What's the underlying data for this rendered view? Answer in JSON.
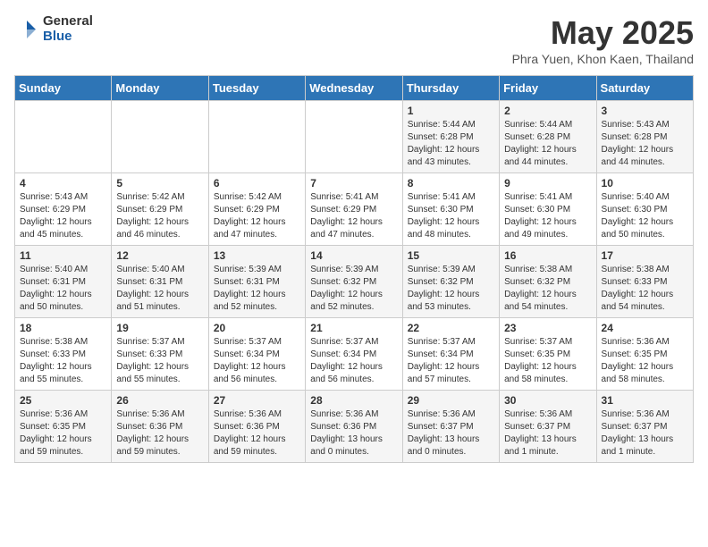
{
  "header": {
    "logo_general": "General",
    "logo_blue": "Blue",
    "title": "May 2025",
    "subtitle": "Phra Yuen, Khon Kaen, Thailand"
  },
  "weekdays": [
    "Sunday",
    "Monday",
    "Tuesday",
    "Wednesday",
    "Thursday",
    "Friday",
    "Saturday"
  ],
  "weeks": [
    [
      {
        "day": "",
        "info": ""
      },
      {
        "day": "",
        "info": ""
      },
      {
        "day": "",
        "info": ""
      },
      {
        "day": "",
        "info": ""
      },
      {
        "day": "1",
        "info": "Sunrise: 5:44 AM\nSunset: 6:28 PM\nDaylight: 12 hours\nand 43 minutes."
      },
      {
        "day": "2",
        "info": "Sunrise: 5:44 AM\nSunset: 6:28 PM\nDaylight: 12 hours\nand 44 minutes."
      },
      {
        "day": "3",
        "info": "Sunrise: 5:43 AM\nSunset: 6:28 PM\nDaylight: 12 hours\nand 44 minutes."
      }
    ],
    [
      {
        "day": "4",
        "info": "Sunrise: 5:43 AM\nSunset: 6:29 PM\nDaylight: 12 hours\nand 45 minutes."
      },
      {
        "day": "5",
        "info": "Sunrise: 5:42 AM\nSunset: 6:29 PM\nDaylight: 12 hours\nand 46 minutes."
      },
      {
        "day": "6",
        "info": "Sunrise: 5:42 AM\nSunset: 6:29 PM\nDaylight: 12 hours\nand 47 minutes."
      },
      {
        "day": "7",
        "info": "Sunrise: 5:41 AM\nSunset: 6:29 PM\nDaylight: 12 hours\nand 47 minutes."
      },
      {
        "day": "8",
        "info": "Sunrise: 5:41 AM\nSunset: 6:30 PM\nDaylight: 12 hours\nand 48 minutes."
      },
      {
        "day": "9",
        "info": "Sunrise: 5:41 AM\nSunset: 6:30 PM\nDaylight: 12 hours\nand 49 minutes."
      },
      {
        "day": "10",
        "info": "Sunrise: 5:40 AM\nSunset: 6:30 PM\nDaylight: 12 hours\nand 50 minutes."
      }
    ],
    [
      {
        "day": "11",
        "info": "Sunrise: 5:40 AM\nSunset: 6:31 PM\nDaylight: 12 hours\nand 50 minutes."
      },
      {
        "day": "12",
        "info": "Sunrise: 5:40 AM\nSunset: 6:31 PM\nDaylight: 12 hours\nand 51 minutes."
      },
      {
        "day": "13",
        "info": "Sunrise: 5:39 AM\nSunset: 6:31 PM\nDaylight: 12 hours\nand 52 minutes."
      },
      {
        "day": "14",
        "info": "Sunrise: 5:39 AM\nSunset: 6:32 PM\nDaylight: 12 hours\nand 52 minutes."
      },
      {
        "day": "15",
        "info": "Sunrise: 5:39 AM\nSunset: 6:32 PM\nDaylight: 12 hours\nand 53 minutes."
      },
      {
        "day": "16",
        "info": "Sunrise: 5:38 AM\nSunset: 6:32 PM\nDaylight: 12 hours\nand 54 minutes."
      },
      {
        "day": "17",
        "info": "Sunrise: 5:38 AM\nSunset: 6:33 PM\nDaylight: 12 hours\nand 54 minutes."
      }
    ],
    [
      {
        "day": "18",
        "info": "Sunrise: 5:38 AM\nSunset: 6:33 PM\nDaylight: 12 hours\nand 55 minutes."
      },
      {
        "day": "19",
        "info": "Sunrise: 5:37 AM\nSunset: 6:33 PM\nDaylight: 12 hours\nand 55 minutes."
      },
      {
        "day": "20",
        "info": "Sunrise: 5:37 AM\nSunset: 6:34 PM\nDaylight: 12 hours\nand 56 minutes."
      },
      {
        "day": "21",
        "info": "Sunrise: 5:37 AM\nSunset: 6:34 PM\nDaylight: 12 hours\nand 56 minutes."
      },
      {
        "day": "22",
        "info": "Sunrise: 5:37 AM\nSunset: 6:34 PM\nDaylight: 12 hours\nand 57 minutes."
      },
      {
        "day": "23",
        "info": "Sunrise: 5:37 AM\nSunset: 6:35 PM\nDaylight: 12 hours\nand 58 minutes."
      },
      {
        "day": "24",
        "info": "Sunrise: 5:36 AM\nSunset: 6:35 PM\nDaylight: 12 hours\nand 58 minutes."
      }
    ],
    [
      {
        "day": "25",
        "info": "Sunrise: 5:36 AM\nSunset: 6:35 PM\nDaylight: 12 hours\nand 59 minutes."
      },
      {
        "day": "26",
        "info": "Sunrise: 5:36 AM\nSunset: 6:36 PM\nDaylight: 12 hours\nand 59 minutes."
      },
      {
        "day": "27",
        "info": "Sunrise: 5:36 AM\nSunset: 6:36 PM\nDaylight: 12 hours\nand 59 minutes."
      },
      {
        "day": "28",
        "info": "Sunrise: 5:36 AM\nSunset: 6:36 PM\nDaylight: 13 hours\nand 0 minutes."
      },
      {
        "day": "29",
        "info": "Sunrise: 5:36 AM\nSunset: 6:37 PM\nDaylight: 13 hours\nand 0 minutes."
      },
      {
        "day": "30",
        "info": "Sunrise: 5:36 AM\nSunset: 6:37 PM\nDaylight: 13 hours\nand 1 minute."
      },
      {
        "day": "31",
        "info": "Sunrise: 5:36 AM\nSunset: 6:37 PM\nDaylight: 13 hours\nand 1 minute."
      }
    ]
  ]
}
